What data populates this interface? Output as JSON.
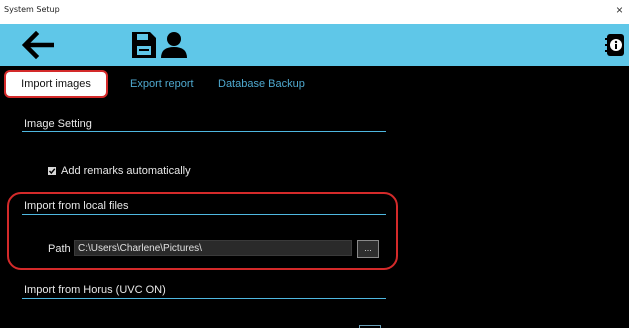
{
  "window": {
    "title": "System Setup",
    "close_glyph": "×"
  },
  "toolbar": {
    "back_icon": "arrow-left-icon",
    "save_icon": "floppy-disk-icon",
    "user_icon": "user-icon",
    "info_icon": "info-notebook-icon"
  },
  "tabs": [
    {
      "label": "Import images",
      "active": true
    },
    {
      "label": "Export report",
      "active": false
    },
    {
      "label": "Database Backup",
      "active": false
    }
  ],
  "image_setting": {
    "title": "Image Setting",
    "add_remarks": {
      "label": "Add remarks automatically",
      "checked": true
    }
  },
  "local_files": {
    "title": "Import from local files",
    "path_label": "Path",
    "path_value": "C:\\Users\\Charlene\\Pictures\\",
    "browse_label": "..."
  },
  "horus": {
    "title": "Import from Horus (UVC ON)"
  },
  "colors": {
    "accent": "#5fc7e8",
    "tab_link": "#4fa9cf",
    "highlight": "#d42a2a",
    "background": "#000000"
  }
}
